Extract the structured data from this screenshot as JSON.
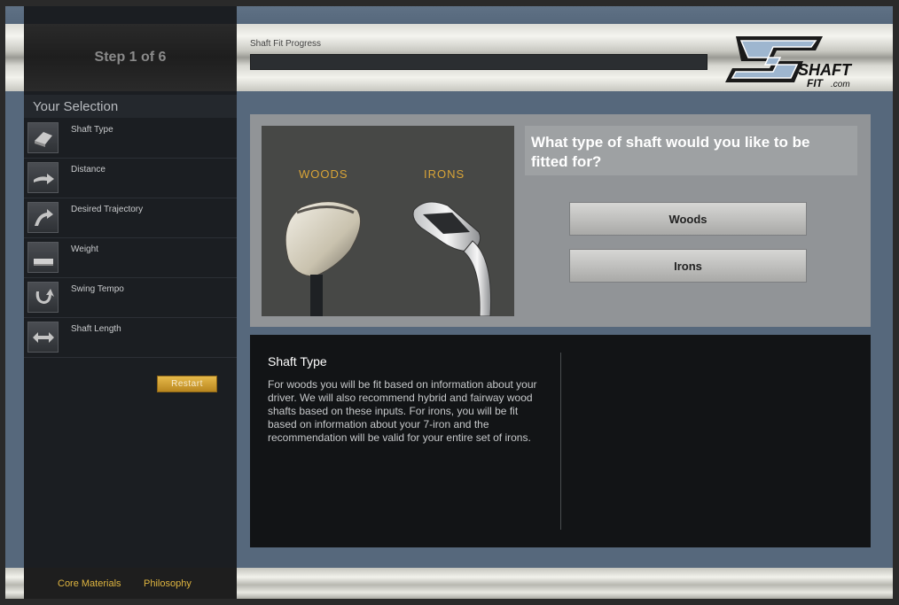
{
  "header": {
    "step_label": "Step 1 of 6",
    "progress_label": "Shaft Fit Progress",
    "progress_value": 0,
    "logo": {
      "mark": "SF",
      "word1": "SHAFT",
      "word2": "FIT",
      "suffix": ".com"
    }
  },
  "sidebar": {
    "title": "Your Selection",
    "items": [
      {
        "label": "Shaft Type",
        "icon": "shaft-type-icon"
      },
      {
        "label": "Distance",
        "icon": "distance-icon"
      },
      {
        "label": "Desired Trajectory",
        "icon": "trajectory-icon"
      },
      {
        "label": "Weight",
        "icon": "weight-icon"
      },
      {
        "label": "Swing Tempo",
        "icon": "swing-tempo-icon"
      },
      {
        "label": "Shaft Length",
        "icon": "shaft-length-icon"
      }
    ],
    "restart_label": "Restart"
  },
  "question": {
    "text": "What type of shaft would you like to be fitted for?",
    "image_labels": {
      "woods": "WOODS",
      "irons": "IRONS"
    },
    "choices": [
      "Woods",
      "Irons"
    ]
  },
  "info": {
    "title": "Shaft Type",
    "body": "For woods you will be fit based on information about your driver. We will also recommend hybrid and fairway wood shafts based on these inputs. For irons, you will be fit based on information about your 7-iron and the recommendation will be valid for your entire set of irons."
  },
  "footer": {
    "links": [
      "Core Materials",
      "Philosophy"
    ]
  },
  "colors": {
    "accent_gold": "#d9a437",
    "panel_dark": "#121416",
    "page_blue": "#56687c"
  }
}
